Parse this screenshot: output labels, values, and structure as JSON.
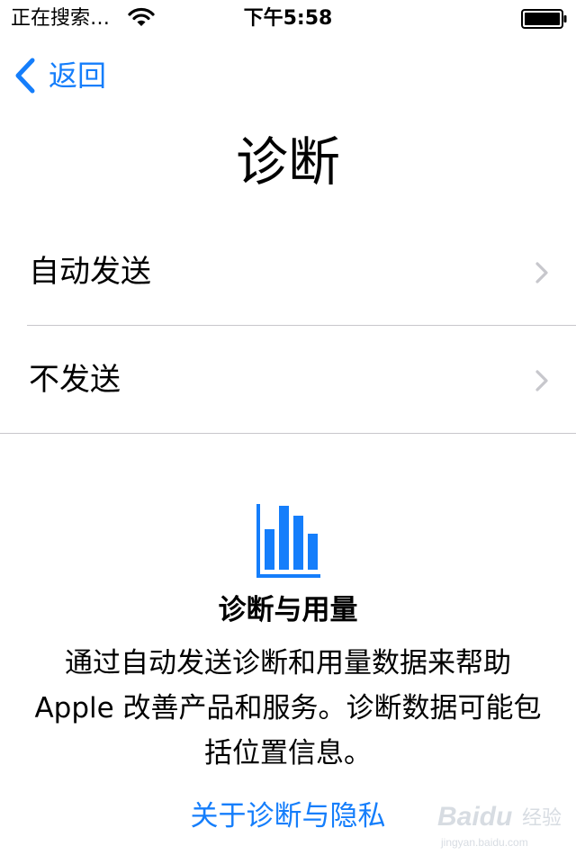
{
  "status_bar": {
    "carrier": "正在搜索…",
    "time": "下午5:58",
    "wifi_icon": "wifi-icon",
    "battery_icon": "battery-icon"
  },
  "nav": {
    "back_label": "返回",
    "back_icon": "chevron-left-icon"
  },
  "page": {
    "title": "诊断"
  },
  "options": [
    {
      "label": "自动发送",
      "icon": "chevron-right-icon"
    },
    {
      "label": "不发送",
      "icon": "chevron-right-icon"
    }
  ],
  "info": {
    "icon": "bar-chart-icon",
    "title": "诊断与用量",
    "text": "通过自动发送诊断和用量数据来帮助 Apple 改善产品和服务。诊断数据可能包括位置信息。",
    "link": "关于诊断与隐私"
  },
  "watermark": {
    "brand": "Baidu",
    "label": "经验",
    "url": "jingyan.baidu.com"
  },
  "colors": {
    "accent": "#157efb",
    "divider": "#c8c7cc",
    "chevron": "#c7c7cc"
  }
}
